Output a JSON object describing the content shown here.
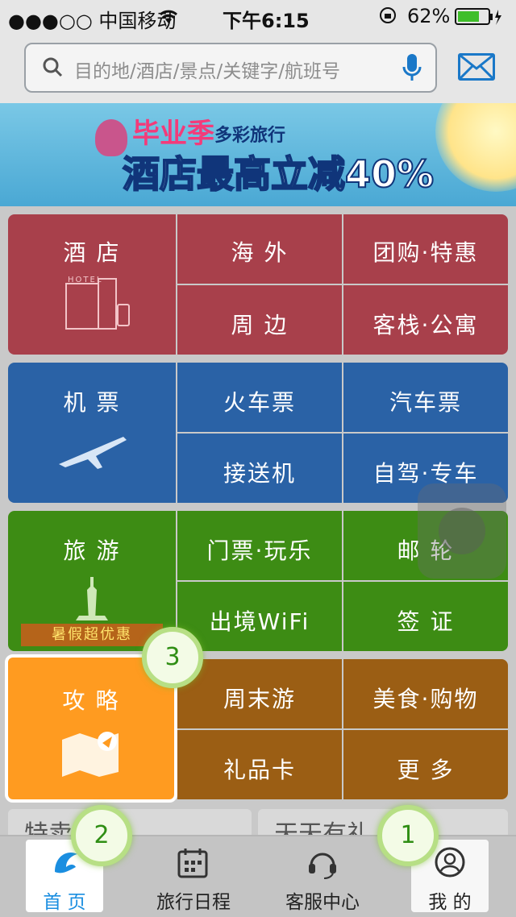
{
  "status_bar": {
    "carrier": "●●●○○ 中国移动",
    "time": "下午6:15",
    "battery_pct": "62%"
  },
  "search": {
    "placeholder": "目的地/酒店/景点/关键字/航班号"
  },
  "banner": {
    "line1": "毕业季",
    "line1b": "多彩旅行",
    "line2": "酒店最高立减40%"
  },
  "hotel": {
    "main": "酒 店",
    "cells": [
      "海 外",
      "团购·特惠",
      "周 边",
      "客栈·公寓"
    ],
    "color": "#a8404b"
  },
  "flight": {
    "main": "机 票",
    "cells": [
      "火车票",
      "汽车票",
      "接送机",
      "自驾·专车"
    ],
    "color": "#2a62a6"
  },
  "travel": {
    "main": "旅 游",
    "promo": "暑假超优惠",
    "cells": [
      "门票·玩乐",
      "邮 轮",
      "出境WiFi",
      "签 证"
    ],
    "color": "#3d8c14"
  },
  "guide": {
    "main": "攻 略",
    "cells": [
      "周末游",
      "美食·购物",
      "礼品卡",
      "更 多"
    ],
    "color": "#9b5e14",
    "highlight": "#ff9b20"
  },
  "promo_row": {
    "left": "特卖",
    "right": "天天有礼"
  },
  "tabs": [
    "首 页",
    "旅行日程",
    "客服中心",
    "我 的"
  ],
  "badges": [
    "3",
    "2",
    "1"
  ]
}
